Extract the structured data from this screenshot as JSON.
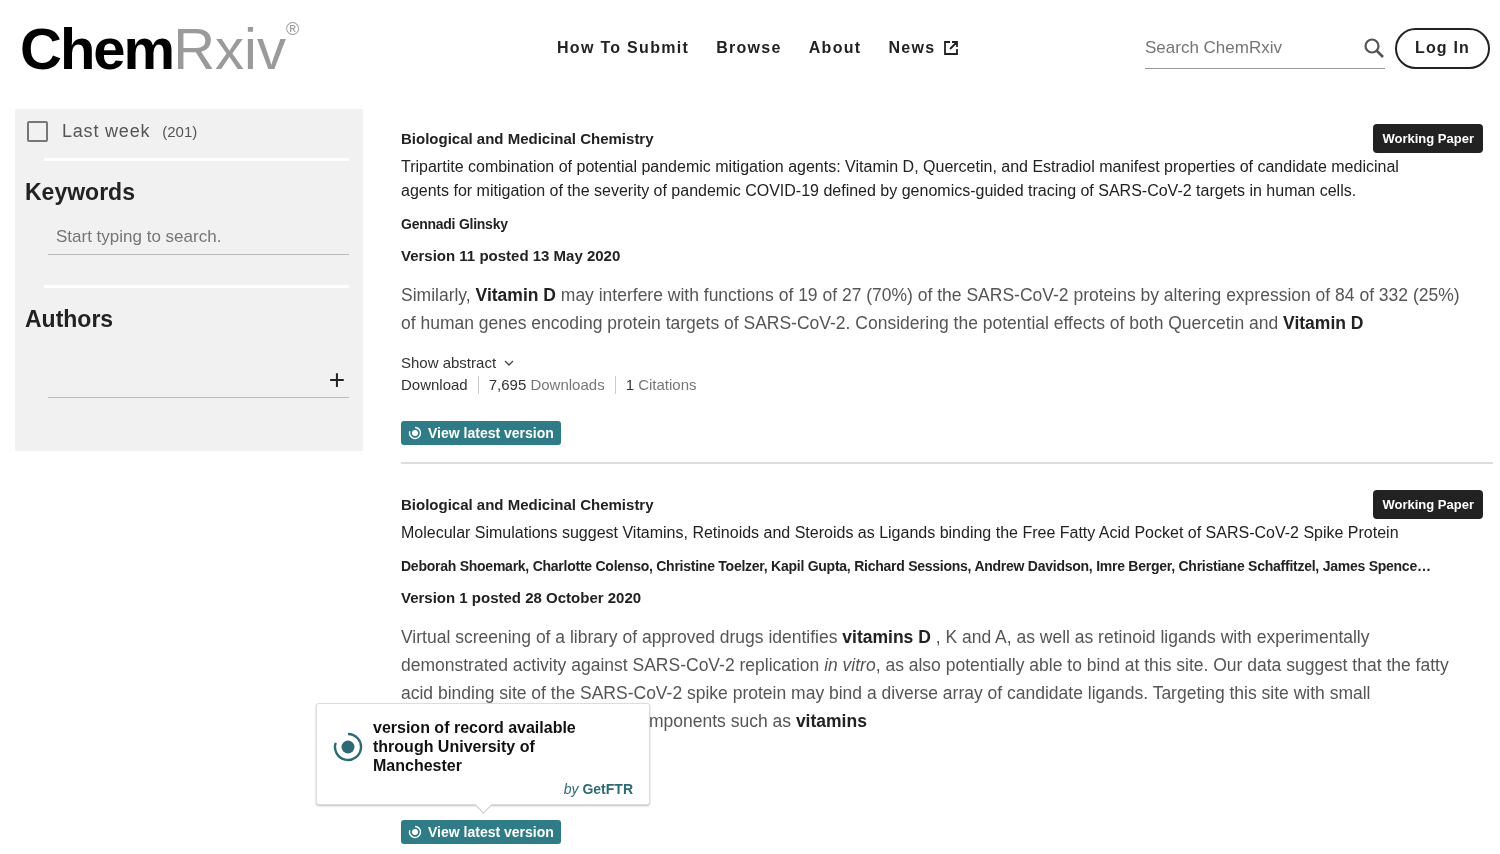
{
  "logo": {
    "bold": "Chem",
    "light": "Rxiv",
    "mark": "®"
  },
  "nav": [
    {
      "label": "How To Submit",
      "external": false
    },
    {
      "label": "Browse",
      "external": false
    },
    {
      "label": "About",
      "external": false
    },
    {
      "label": "News",
      "external": true
    }
  ],
  "search": {
    "placeholder": "Search ChemRxiv"
  },
  "login": "Log In",
  "sidebar": {
    "filter": {
      "label": "Last week",
      "count": "(201)",
      "checked": false
    },
    "keywords": {
      "heading": "Keywords",
      "placeholder": "Start typing to search."
    },
    "authors": {
      "heading": "Authors",
      "add": "+"
    }
  },
  "results": [
    {
      "category": "Biological and Medicinal Chemistry",
      "badge": "Working Paper",
      "title": "Tripartite combination of potential pandemic mitigation agents: Vitamin D, Quercetin, and Estradiol manifest properties of candidate medicinal agents for mitigation of the severity of pandemic COVID-19 defined by genomics-guided tracing of SARS-CoV-2 targets in human cells.",
      "authors": "Gennadi Glinsky",
      "version": "Version 11 posted 13 May 2020",
      "abstract": "Similarly, **Vitamin D** may interfere with functions of 19 of 27 (70%) of the SARS-CoV-2 proteins by altering expression of 84 of 332 (25%) of human genes encoding protein targets of SARS-CoV-2. Considering the potential effects of both Quercetin and **Vitamin D**",
      "show_abstract": "Show abstract",
      "download": "Download",
      "downloads": {
        "count": "7,695",
        "label": "Downloads"
      },
      "citations": {
        "count": "1",
        "label": "Citations"
      },
      "latest": "View latest version"
    },
    {
      "category": "Biological and Medicinal Chemistry",
      "badge": "Working Paper",
      "title": "Molecular Simulations suggest Vitamins, Retinoids and Steroids as Ligands binding the Free Fatty Acid Pocket of SARS-CoV-2 Spike Protein",
      "authors": "Deborah Shoemark, Charlotte Colenso, Christine Toelzer, Kapil Gupta, Richard Sessions, Andrew Davidson, Imre Berger, Christiane Schaffitzel, James Spence…",
      "version": "Version 1 posted 28 October 2020",
      "abstract": "Virtual screening of a library of approved drugs identifies **vitamins D** , K and A, as well as retinoid ligands with experimentally demonstrated activity against SARS-CoV-2 replication *in vitro*, as also potentially able to bind at this site. Our data suggest that the fatty acid binding site of the SARS-CoV-2 spike protein may bind a diverse array of candidate ligands. Targeting this site with small",
      "abstract_tail": "mponents such as **vitamins**",
      "latest": "View latest version",
      "tooltip": {
        "text": "version of record available through University of Manchester",
        "by": "by",
        "provider": "GetFTR"
      }
    }
  ]
}
